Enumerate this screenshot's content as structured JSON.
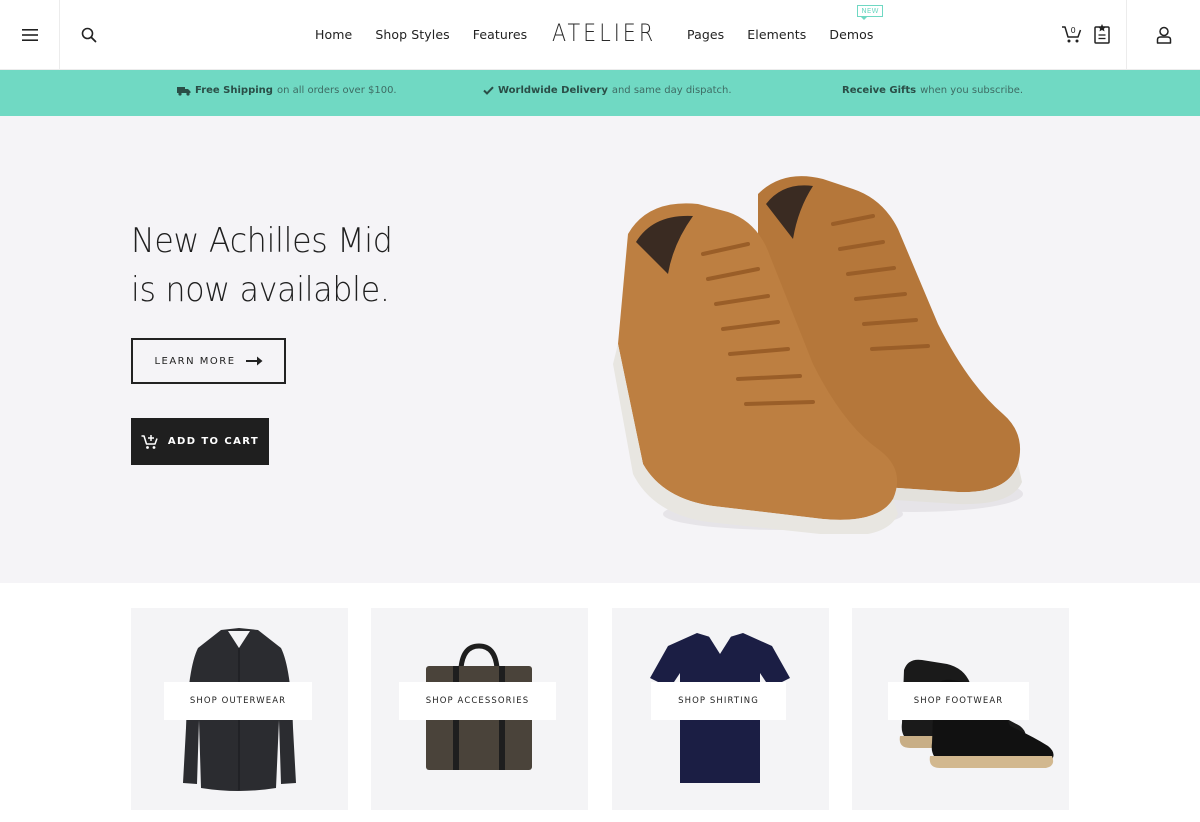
{
  "header": {
    "logo": "ATELIER",
    "nav_left": [
      "Home",
      "Shop Styles",
      "Features"
    ],
    "nav_right": [
      "Pages",
      "Elements",
      "Demos"
    ],
    "demos_badge": "NEW",
    "cart_count": "0",
    "icons": [
      "menu-icon",
      "search-icon",
      "cart-icon",
      "wishlist-icon",
      "account-icon"
    ]
  },
  "promo": {
    "shipping_bold": "Free Shipping",
    "shipping_rest": "on all orders over $100.",
    "delivery_bold": "Worldwide Delivery",
    "delivery_rest": "and same day dispatch.",
    "gifts_bold": "Receive Gifts",
    "gifts_rest": "when you subscribe."
  },
  "hero": {
    "title_line1": "New Achilles Mid",
    "title_line2": "is now available.",
    "learn_more": "LEARN MORE",
    "add_to_cart": "ADD TO CART"
  },
  "categories": [
    {
      "label": "SHOP OUTERWEAR"
    },
    {
      "label": "SHOP ACCESSORIES"
    },
    {
      "label": "SHOP SHIRTING"
    },
    {
      "label": "SHOP FOOTWEAR"
    }
  ],
  "colors": {
    "accent": "#70d9c3",
    "hero_bg": "#f5f4f7",
    "dark": "#1f1f1f"
  }
}
